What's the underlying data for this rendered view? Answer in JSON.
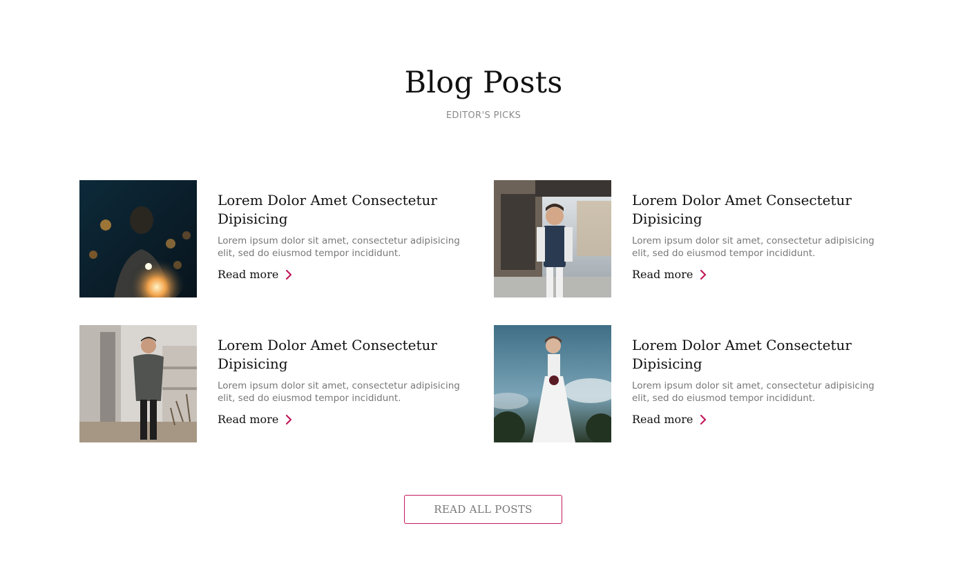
{
  "header": {
    "title": "Blog Posts",
    "subtitle": "EDITOR'S PICKS"
  },
  "posts": [
    {
      "title": "Lorem Dolor Amet Consectetur Dipisicing",
      "excerpt": "Lorem ipsum dolor sit amet, consectetur adipisicing elit, sed do eiusmod tempor incididunt.",
      "read_more": "Read more",
      "image_alt": "person holding sparkler at night"
    },
    {
      "title": "Lorem Dolor Amet Consectetur Dipisicing",
      "excerpt": "Lorem ipsum dolor sit amet, consectetur adipisicing elit, sed do eiusmod tempor incididunt.",
      "read_more": "Read more",
      "image_alt": "man in vest and glasses on street"
    },
    {
      "title": "Lorem Dolor Amet Consectetur Dipisicing",
      "excerpt": "Lorem ipsum dolor sit amet, consectetur adipisicing elit, sed do eiusmod tempor incididunt.",
      "read_more": "Read more",
      "image_alt": "man in grey coat by building"
    },
    {
      "title": "Lorem Dolor Amet Consectetur Dipisicing",
      "excerpt": "Lorem ipsum dolor sit amet, consectetur adipisicing elit, sed do eiusmod tempor incididunt.",
      "read_more": "Read more",
      "image_alt": "woman in white dress under sky"
    }
  ],
  "footer": {
    "read_all_label": "READ ALL POSTS"
  },
  "colors": {
    "accent": "#c2185b",
    "muted_text": "#777777"
  }
}
